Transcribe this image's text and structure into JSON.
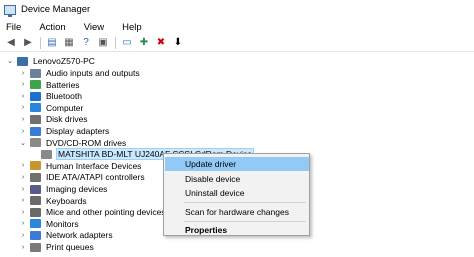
{
  "window": {
    "title": "Device Manager"
  },
  "menu": [
    "File",
    "Action",
    "View",
    "Help"
  ],
  "toolbar": [
    {
      "name": "back-icon",
      "glyph": "◀",
      "color": "#555555"
    },
    {
      "name": "forward-icon",
      "glyph": "▶",
      "color": "#555555"
    },
    {
      "name": "properties-icon",
      "glyph": "▤",
      "color": "#3d6fb6"
    },
    {
      "name": "list-icon",
      "glyph": "▦",
      "color": "#555555"
    },
    {
      "name": "help-icon",
      "glyph": "?",
      "color": "#1f5fbf"
    },
    {
      "name": "grid-icon",
      "glyph": "▣",
      "color": "#555555"
    },
    {
      "name": "monitor-icon",
      "glyph": "▭",
      "color": "#2b6cb0"
    },
    {
      "name": "add-driver-icon",
      "glyph": "✚",
      "color": "#2e8b57"
    },
    {
      "name": "uninstall-icon",
      "glyph": "✖",
      "color": "#d40000"
    },
    {
      "name": "download-icon",
      "glyph": "⬇",
      "color": "#000000"
    }
  ],
  "tree": {
    "root": "LenovoZ570-PC",
    "items": [
      {
        "label": "Audio inputs and outputs",
        "expander": "›",
        "color": "#6e7f9c"
      },
      {
        "label": "Batteries",
        "expander": "›",
        "color": "#3fa34d"
      },
      {
        "label": "Bluetooth",
        "expander": "›",
        "color": "#1f6fd0"
      },
      {
        "label": "Computer",
        "expander": "›",
        "color": "#2b86d9"
      },
      {
        "label": "Disk drives",
        "expander": "›",
        "color": "#707070"
      },
      {
        "label": "Display adapters",
        "expander": "›",
        "color": "#3a7bd5"
      },
      {
        "label": "DVD/CD-ROM drives",
        "expander": "⌄",
        "color": "#8a8a8a"
      },
      {
        "label": "MATSHITA BD-MLT UJ240AF SCSI CdRom Device",
        "expander": "",
        "color": "#8a8a8a",
        "child": true,
        "selected": true
      },
      {
        "label": "Human Interface Devices",
        "expander": "›",
        "color": "#c8962e"
      },
      {
        "label": "IDE ATA/ATAPI controllers",
        "expander": "›",
        "color": "#707070"
      },
      {
        "label": "Imaging devices",
        "expander": "›",
        "color": "#5a5a8a"
      },
      {
        "label": "Keyboards",
        "expander": "›",
        "color": "#6a6a6a"
      },
      {
        "label": "Mice and other pointing devices",
        "expander": "›",
        "color": "#6a6a6a"
      },
      {
        "label": "Monitors",
        "expander": "›",
        "color": "#2b86d9"
      },
      {
        "label": "Network adapters",
        "expander": "›",
        "color": "#3a7bd5"
      },
      {
        "label": "Print queues",
        "expander": "›",
        "color": "#7a7a7a"
      }
    ]
  },
  "context_menu": {
    "items": [
      "Update driver",
      "Disable device",
      "Uninstall device",
      "Scan for hardware changes",
      "Properties"
    ]
  }
}
